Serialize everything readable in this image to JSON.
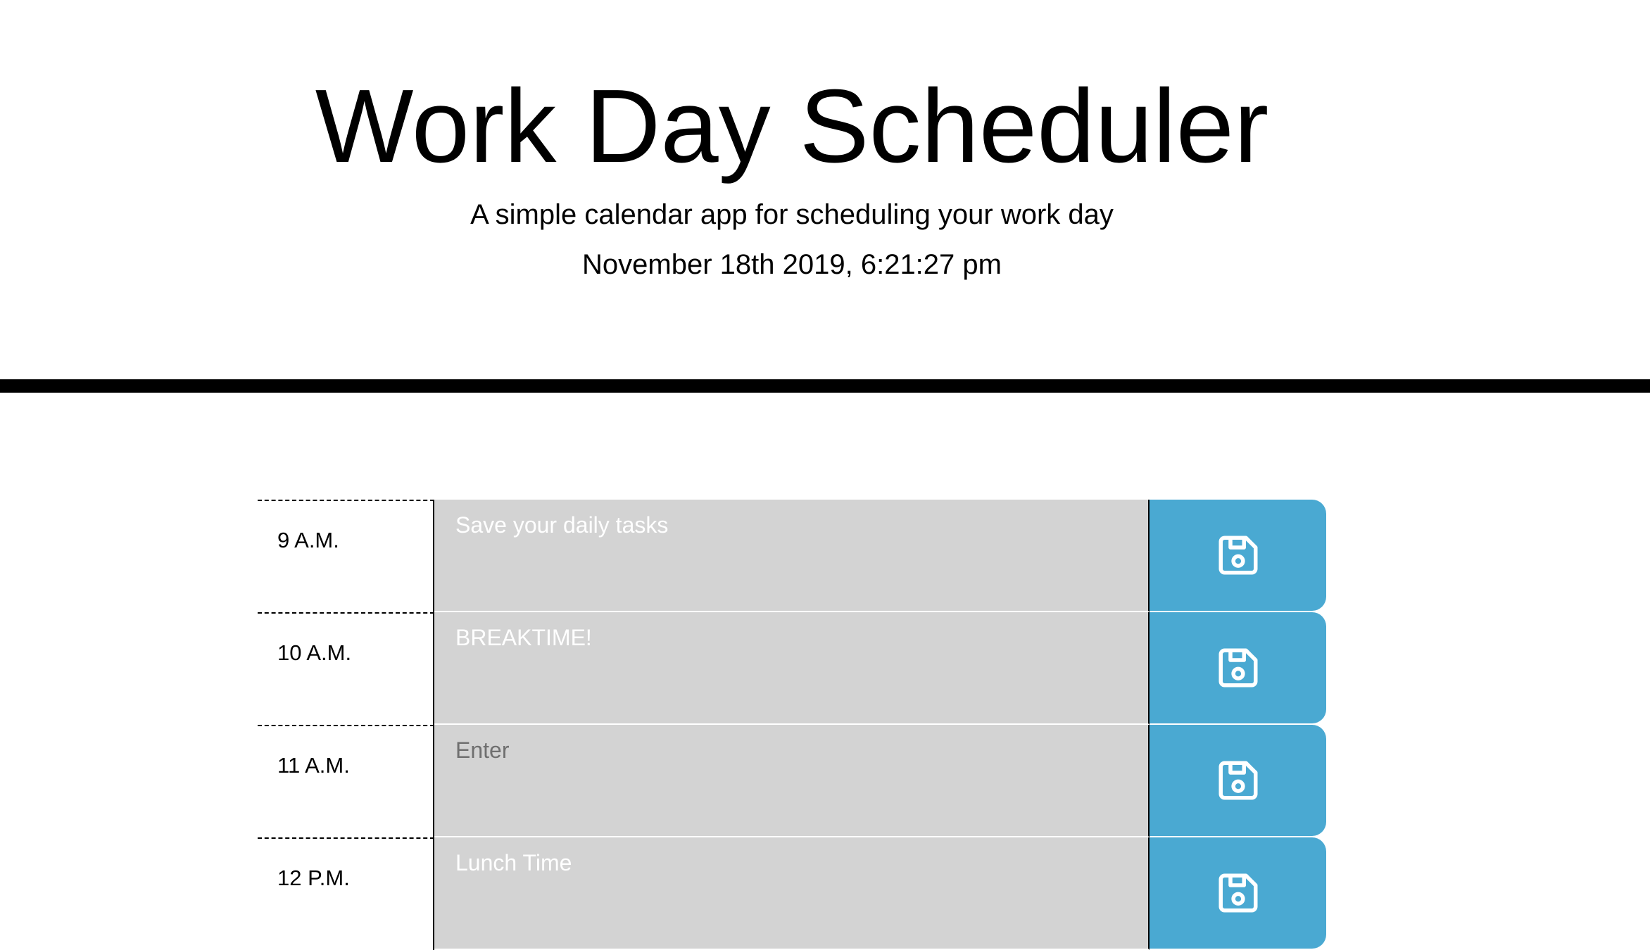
{
  "header": {
    "title": "Work Day Scheduler",
    "subtitle": "A simple calendar app for scheduling your work day",
    "current_date": "November 18th 2019, 6:21:27 pm"
  },
  "colors": {
    "task_background": "#d3d3d3",
    "save_button": "#4aa9d2",
    "divider": "#000000"
  },
  "schedule": {
    "rows": [
      {
        "hour": "9 A.M.",
        "task": "Save your daily tasks",
        "placeholder": ""
      },
      {
        "hour": "10 A.M.",
        "task": "BREAKTIME!",
        "placeholder": ""
      },
      {
        "hour": "11 A.M.",
        "task": "",
        "placeholder": "Enter"
      },
      {
        "hour": "12 P.M.",
        "task": "Lunch Time",
        "placeholder": ""
      }
    ],
    "save_icon": "save-icon"
  }
}
